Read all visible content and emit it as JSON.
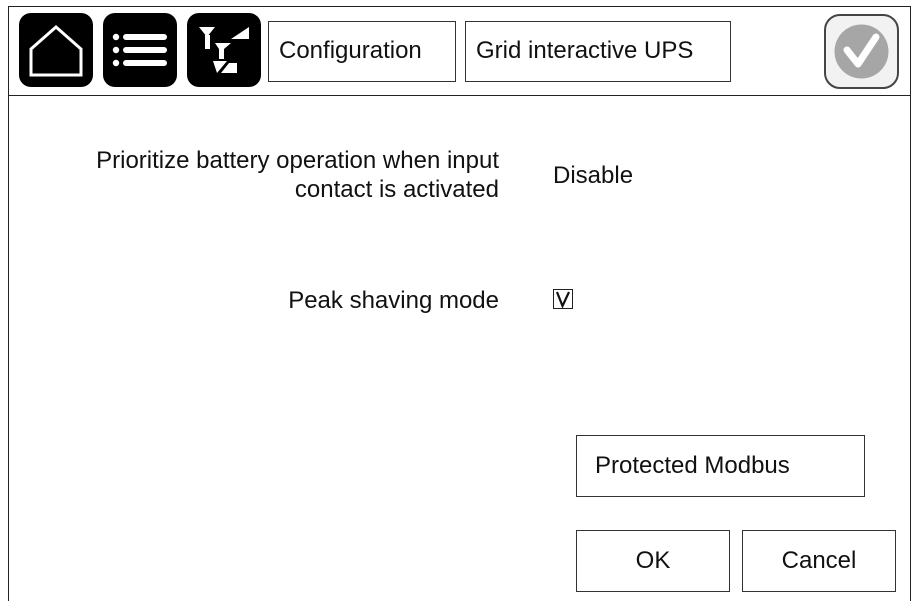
{
  "toolbar": {
    "home_icon": "home-icon",
    "menu_icon": "list-menu-icon",
    "transfer_icon": "transfer-icon"
  },
  "breadcrumb": {
    "items": [
      {
        "label": "Configuration"
      },
      {
        "label": "Grid interactive UPS"
      }
    ]
  },
  "status": {
    "icon": "status-ok-check-icon"
  },
  "settings": {
    "prioritize_battery": {
      "label_line1": "Prioritize battery operation when input",
      "label_line2": "contact is activated",
      "value": "Disable"
    },
    "peak_shaving": {
      "label": "Peak shaving mode",
      "checked": true
    }
  },
  "actions": {
    "protected_modbus": "Protected Modbus",
    "ok": "OK",
    "cancel": "Cancel"
  }
}
